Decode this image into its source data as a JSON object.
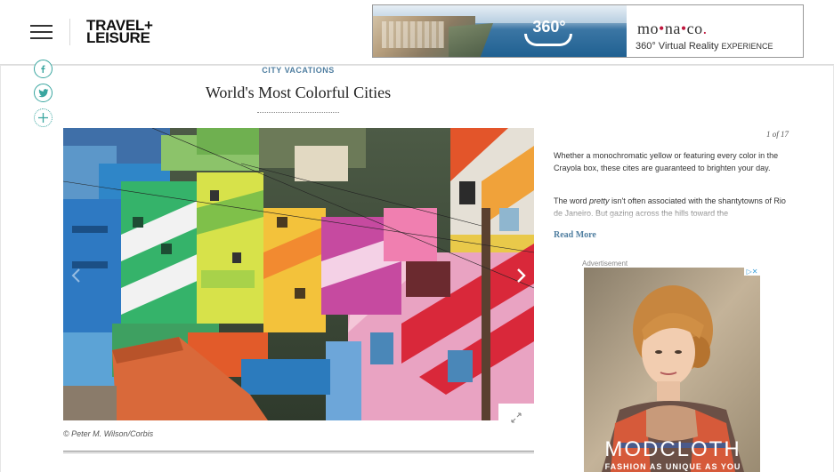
{
  "header": {
    "logo_line1": "TRAVEL+",
    "logo_line2": "LEISURE"
  },
  "top_ad": {
    "badge": "360°",
    "brand": "mo",
    "brand_mid": "na",
    "brand_end": "co",
    "tagline": "360° Virtual Reality ",
    "tagline_suffix": "EXPERIENCE"
  },
  "article": {
    "section": "CITY VACATIONS",
    "title": "World's Most Colorful Cities",
    "image_credit": "© Peter M. Wilson/Corbis",
    "slide_counter": "1 of 17",
    "description_1": "Whether a monochromatic yellow or featuring every color in the Crayola box, these cites are guaranteed to brighten your day.",
    "description_2a": "The word ",
    "description_2_em": "pretty",
    "description_2b": " isn't often associated with the shantytowns of Rio de Janeiro. But gazing across the hills toward the",
    "read_more": "Read More"
  },
  "side_ad": {
    "label": "Advertisement",
    "headline": "MODCLOTH",
    "subline": "FASHION AS UNIQUE AS YOU",
    "adchoices": "▷✕"
  },
  "colors": {
    "accent": "#4f7ea0",
    "social": "#3aa6a0"
  }
}
